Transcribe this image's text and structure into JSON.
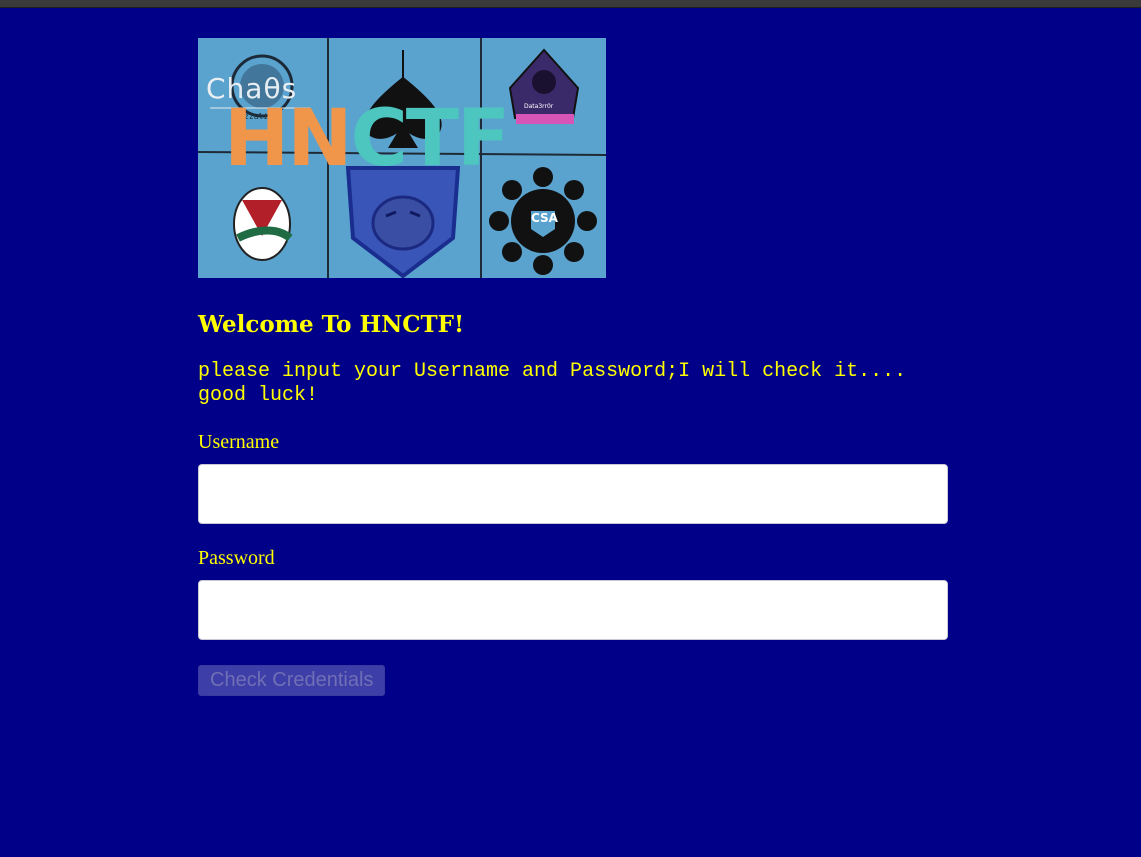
{
  "banner": {
    "word_part1": "HN",
    "word_part2": "CTF",
    "chaos_text": "Chaθs",
    "chaos_sub": "zzuli",
    "datasec_text": "Data3rr0r",
    "csa_text": "CSA"
  },
  "welcome_title": "Welcome To HNCTF!",
  "instructions": "please input your Username and Password;I will check it.... good luck!",
  "form": {
    "username_label": "Username",
    "username_value": "",
    "password_label": "Password",
    "password_value": "",
    "submit_label": "Check Credentials"
  },
  "colors": {
    "background": "#000088",
    "text": "#ffff00",
    "button": "#3e3ea8"
  }
}
